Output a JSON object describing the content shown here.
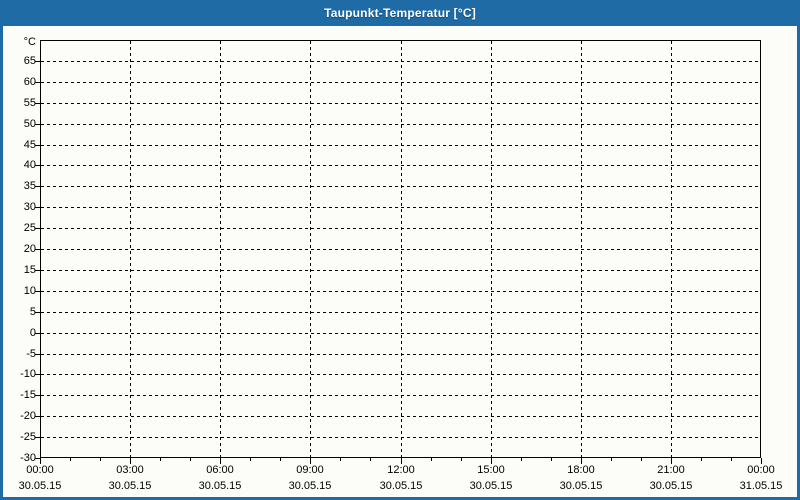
{
  "window": {
    "title": "Taupunkt-Temperatur [°C]"
  },
  "chart_data": {
    "type": "line",
    "title": "Taupunkt-Temperatur [°C]",
    "xlabel": "",
    "ylabel": "°C",
    "ylim": [
      -30,
      70
    ],
    "yticks": [
      65,
      60,
      55,
      50,
      45,
      40,
      35,
      30,
      25,
      20,
      15,
      10,
      5,
      0,
      -5,
      -10,
      -15,
      -20,
      -25,
      -30
    ],
    "ytick_step": 5,
    "grid": "dashed",
    "legend": "none",
    "x_major_ticks": [
      {
        "time": "00:00",
        "date": "30.05.15"
      },
      {
        "time": "03:00",
        "date": "30.05.15"
      },
      {
        "time": "06:00",
        "date": "30.05.15"
      },
      {
        "time": "09:00",
        "date": "30.05.15"
      },
      {
        "time": "12:00",
        "date": "30.05.15"
      },
      {
        "time": "15:00",
        "date": "30.05.15"
      },
      {
        "time": "18:00",
        "date": "30.05.15"
      },
      {
        "time": "21:00",
        "date": "30.05.15"
      },
      {
        "time": "00:00",
        "date": "31.05.15"
      }
    ],
    "x_minor_per_major": 3,
    "x_span_hours": 24,
    "series": [],
    "colors": {
      "titlebar_bg": "#1F6BA5",
      "title_text": "#FFFFFF",
      "frame": "#1F6BA5",
      "axis": "#000000",
      "grid": "#000000",
      "label_text": "#000000",
      "page_bg": "#FCFCF9"
    }
  }
}
